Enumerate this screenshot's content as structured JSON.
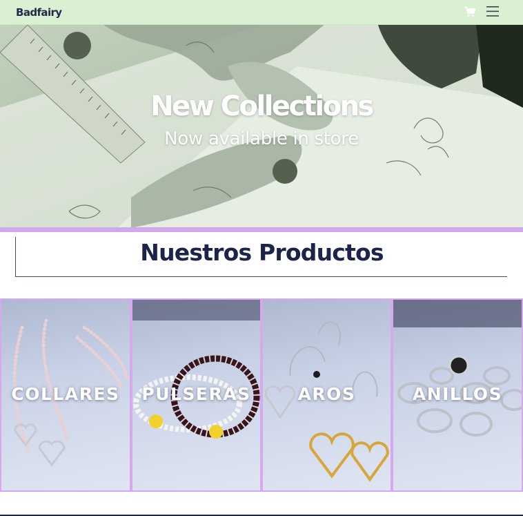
{
  "nav": {
    "brand": "Badfairy",
    "background_color": "#d9f0d2",
    "icons": [
      "shopping-cart-icon",
      "hamburger-menu-icon"
    ]
  },
  "hero": {
    "title": "New Collections",
    "subtitle": "Now available in store",
    "accent_color": "#d3a8ea"
  },
  "products": {
    "heading": "Nuestros Productos",
    "categories": [
      {
        "label": "COLLARES"
      },
      {
        "label": "PULSERAS"
      },
      {
        "label": "AROS"
      },
      {
        "label": "ANILLOS"
      }
    ]
  }
}
